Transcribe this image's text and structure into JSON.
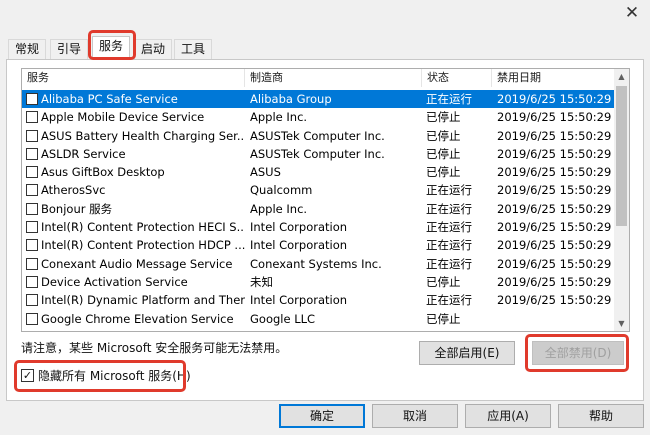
{
  "window": {
    "close_glyph": "✕"
  },
  "tabs": [
    {
      "label": "常规"
    },
    {
      "label": "引导"
    },
    {
      "label": "服务"
    },
    {
      "label": "启动"
    },
    {
      "label": "工具"
    }
  ],
  "services": {
    "headers": {
      "name": "服务",
      "vendor": "制造商",
      "status": "状态",
      "date": "禁用日期"
    },
    "rows": [
      {
        "name": "Alibaba PC Safe Service",
        "vendor": "Alibaba Group",
        "status": "正在运行",
        "date": "2019/6/25 15:50:29",
        "checked": false,
        "selected": true
      },
      {
        "name": "Apple Mobile Device Service",
        "vendor": "Apple Inc.",
        "status": "已停止",
        "date": "2019/6/25 15:50:29",
        "checked": false
      },
      {
        "name": "ASUS Battery Health Charging Ser...",
        "vendor": "ASUSTek Computer Inc.",
        "status": "已停止",
        "date": "2019/6/25 15:50:29",
        "checked": false
      },
      {
        "name": "ASLDR Service",
        "vendor": "ASUSTek Computer Inc.",
        "status": "已停止",
        "date": "2019/6/25 15:50:29",
        "checked": false
      },
      {
        "name": "Asus GiftBox Desktop",
        "vendor": "ASUS",
        "status": "已停止",
        "date": "2019/6/25 15:50:29",
        "checked": false
      },
      {
        "name": "AtherosSvc",
        "vendor": "Qualcomm",
        "status": "正在运行",
        "date": "2019/6/25 15:50:29",
        "checked": false
      },
      {
        "name": "Bonjour 服务",
        "vendor": "Apple Inc.",
        "status": "正在运行",
        "date": "2019/6/25 15:50:29",
        "checked": false
      },
      {
        "name": "Intel(R) Content Protection HECI S...",
        "vendor": "Intel Corporation",
        "status": "正在运行",
        "date": "2019/6/25 15:50:29",
        "checked": false
      },
      {
        "name": "Intel(R) Content Protection HDCP ...",
        "vendor": "Intel Corporation",
        "status": "正在运行",
        "date": "2019/6/25 15:50:29",
        "checked": false
      },
      {
        "name": "Conexant Audio Message Service",
        "vendor": "Conexant Systems Inc.",
        "status": "正在运行",
        "date": "2019/6/25 15:50:29",
        "checked": false
      },
      {
        "name": "Device Activation Service",
        "vendor": "未知",
        "status": "已停止",
        "date": "2019/6/25 15:50:29",
        "checked": false
      },
      {
        "name": "Intel(R) Dynamic Platform and Ther...",
        "vendor": "Intel Corporation",
        "status": "正在运行",
        "date": "2019/6/25 15:50:29",
        "checked": false
      },
      {
        "name": "Google Chrome Elevation Service",
        "vendor": "Google LLC",
        "status": "已停止",
        "date": "",
        "checked": false
      }
    ]
  },
  "note": "请注意，某些 Microsoft 安全服务可能无法禁用。",
  "buttons": {
    "enable_all": "全部启用(E)",
    "disable_all": "全部禁用(D)",
    "ok": "确定",
    "cancel": "取消",
    "apply": "应用(A)",
    "help": "帮助"
  },
  "hide_ms": {
    "label": "隐藏所有 Microsoft 服务(H)",
    "checked": true,
    "check_glyph": "✓"
  },
  "scroll": {
    "up_glyph": "▲",
    "down_glyph": "▼"
  },
  "colors": {
    "highlight": "#e03a2c",
    "selection": "#0078d7"
  }
}
